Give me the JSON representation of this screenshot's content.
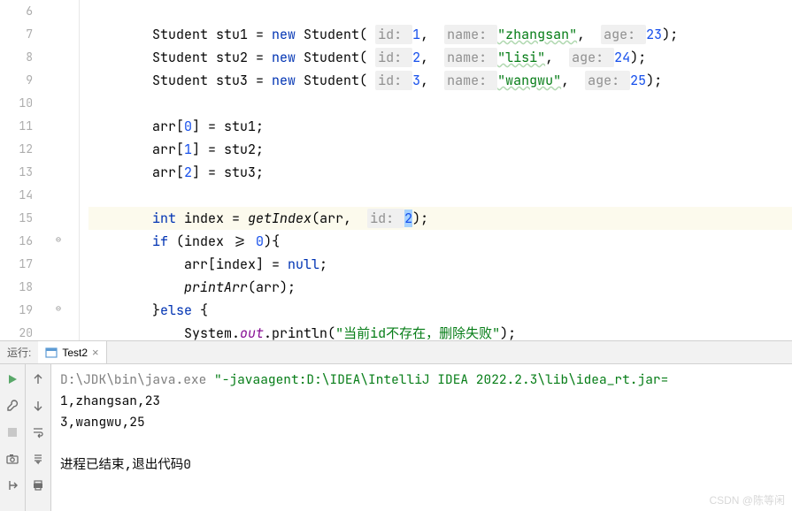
{
  "editor": {
    "line_start": 6,
    "lines": [
      {
        "n": 6,
        "indent": "        ",
        "tokens": []
      },
      {
        "n": 7,
        "indent": "        ",
        "tokens": [
          {
            "t": "Student stu1 = ",
            "cls": ""
          },
          {
            "t": "new",
            "cls": "kw"
          },
          {
            "t": " Student( ",
            "cls": ""
          },
          {
            "t": "id: ",
            "cls": "param param-bg"
          },
          {
            "t": "1",
            "cls": "num"
          },
          {
            "t": ",  ",
            "cls": ""
          },
          {
            "t": "name: ",
            "cls": "param param-bg"
          },
          {
            "t": "\"zhangsan\"",
            "cls": "str str-underline"
          },
          {
            "t": ",  ",
            "cls": ""
          },
          {
            "t": "age: ",
            "cls": "param param-bg"
          },
          {
            "t": "23",
            "cls": "num"
          },
          {
            "t": ");",
            "cls": ""
          }
        ]
      },
      {
        "n": 8,
        "indent": "        ",
        "tokens": [
          {
            "t": "Student stu2 = ",
            "cls": ""
          },
          {
            "t": "new",
            "cls": "kw"
          },
          {
            "t": " Student( ",
            "cls": ""
          },
          {
            "t": "id: ",
            "cls": "param param-bg"
          },
          {
            "t": "2",
            "cls": "num"
          },
          {
            "t": ",  ",
            "cls": ""
          },
          {
            "t": "name: ",
            "cls": "param param-bg"
          },
          {
            "t": "\"lisi\"",
            "cls": "str str-underline"
          },
          {
            "t": ",  ",
            "cls": ""
          },
          {
            "t": "age: ",
            "cls": "param param-bg"
          },
          {
            "t": "24",
            "cls": "num"
          },
          {
            "t": ");",
            "cls": ""
          }
        ]
      },
      {
        "n": 9,
        "indent": "        ",
        "tokens": [
          {
            "t": "Student stu3 = ",
            "cls": ""
          },
          {
            "t": "new",
            "cls": "kw"
          },
          {
            "t": " Student( ",
            "cls": ""
          },
          {
            "t": "id: ",
            "cls": "param param-bg"
          },
          {
            "t": "3",
            "cls": "num"
          },
          {
            "t": ",  ",
            "cls": ""
          },
          {
            "t": "name: ",
            "cls": "param param-bg"
          },
          {
            "t": "\"wangwu\"",
            "cls": "str str-underline"
          },
          {
            "t": ",  ",
            "cls": ""
          },
          {
            "t": "age: ",
            "cls": "param param-bg"
          },
          {
            "t": "25",
            "cls": "num"
          },
          {
            "t": ");",
            "cls": ""
          }
        ]
      },
      {
        "n": 10,
        "indent": "",
        "tokens": []
      },
      {
        "n": 11,
        "indent": "        ",
        "tokens": [
          {
            "t": "arr[",
            "cls": ""
          },
          {
            "t": "0",
            "cls": "num"
          },
          {
            "t": "] = stu1;",
            "cls": ""
          }
        ]
      },
      {
        "n": 12,
        "indent": "        ",
        "tokens": [
          {
            "t": "arr[",
            "cls": ""
          },
          {
            "t": "1",
            "cls": "num"
          },
          {
            "t": "] = stu2;",
            "cls": ""
          }
        ]
      },
      {
        "n": 13,
        "indent": "        ",
        "tokens": [
          {
            "t": "arr[",
            "cls": ""
          },
          {
            "t": "2",
            "cls": "num"
          },
          {
            "t": "] = stu3;",
            "cls": ""
          }
        ]
      },
      {
        "n": 14,
        "indent": "",
        "tokens": []
      },
      {
        "n": 15,
        "indent": "        ",
        "highlight": true,
        "tokens": [
          {
            "t": "int",
            "cls": "kw"
          },
          {
            "t": " index = ",
            "cls": ""
          },
          {
            "t": "getIndex",
            "cls": "method-call"
          },
          {
            "t": "(arr,  ",
            "cls": ""
          },
          {
            "t": "id: ",
            "cls": "param param-bg"
          },
          {
            "t": "2",
            "cls": "num cursor-sel"
          },
          {
            "t": ");",
            "cls": ""
          }
        ]
      },
      {
        "n": 16,
        "indent": "        ",
        "tokens": [
          {
            "t": "if",
            "cls": "kw"
          },
          {
            "t": " (index >= ",
            "cls": ""
          },
          {
            "t": "0",
            "cls": "num"
          },
          {
            "t": "){",
            "cls": ""
          }
        ]
      },
      {
        "n": 17,
        "indent": "            ",
        "tokens": [
          {
            "t": "arr[index] = ",
            "cls": ""
          },
          {
            "t": "null",
            "cls": "kw"
          },
          {
            "t": ";",
            "cls": ""
          }
        ]
      },
      {
        "n": 18,
        "indent": "            ",
        "tokens": [
          {
            "t": "printArr",
            "cls": "method-call"
          },
          {
            "t": "(arr);",
            "cls": ""
          }
        ]
      },
      {
        "n": 19,
        "indent": "        ",
        "tokens": [
          {
            "t": "}",
            "cls": ""
          },
          {
            "t": "else",
            "cls": "kw"
          },
          {
            "t": " {",
            "cls": ""
          }
        ]
      },
      {
        "n": 20,
        "indent": "            ",
        "tokens": [
          {
            "t": "System.",
            "cls": ""
          },
          {
            "t": "out",
            "cls": "static-ref"
          },
          {
            "t": ".println(",
            "cls": ""
          },
          {
            "t": "\"当前id不存在，删除失败\"",
            "cls": "str"
          },
          {
            "t": ");",
            "cls": ""
          }
        ]
      }
    ]
  },
  "run": {
    "label": "运行:",
    "tab_name": "Test2",
    "console_lines": [
      {
        "segments": [
          {
            "t": "D:\\JDK\\bin\\java.exe ",
            "cls": "cmd"
          },
          {
            "t": "\"-javaagent:D:\\IDEA\\IntelliJ IDEA 2022.2.3\\lib\\idea_rt.jar=",
            "cls": "opt"
          }
        ]
      },
      {
        "segments": [
          {
            "t": "1,zhangsan,23",
            "cls": "out"
          }
        ]
      },
      {
        "segments": [
          {
            "t": "3,wangwu,25",
            "cls": "out"
          }
        ]
      },
      {
        "segments": [
          {
            "t": "",
            "cls": "out"
          }
        ]
      },
      {
        "segments": [
          {
            "t": "进程已结束,退出代码0",
            "cls": "out"
          }
        ]
      }
    ]
  },
  "watermark": "CSDN @陈等闲"
}
